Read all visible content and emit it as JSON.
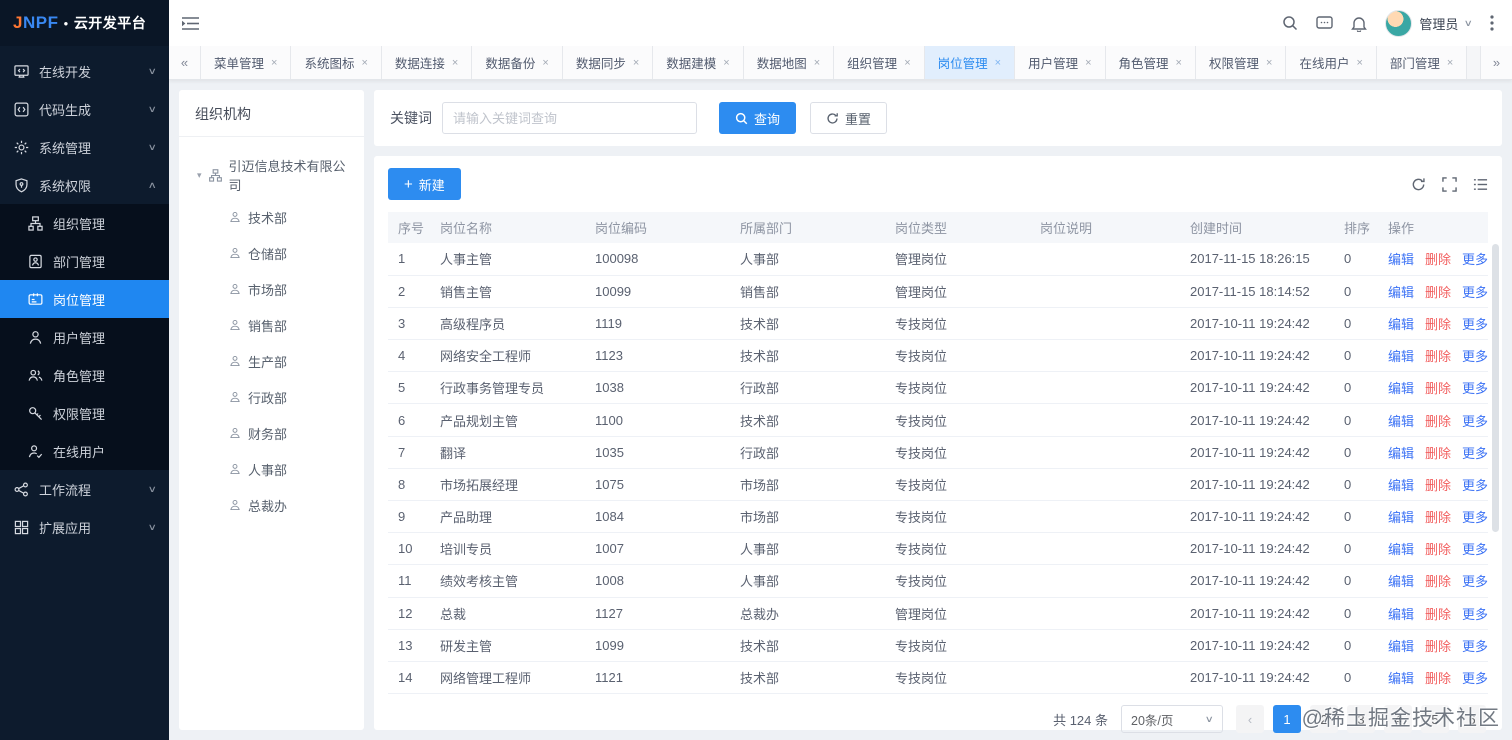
{
  "logo": {
    "brand_j": "J",
    "brand_rest": "NPF",
    "separator": "●",
    "name": "云开发平台"
  },
  "sidebar": {
    "groups_top": [
      {
        "label": "在线开发",
        "slug": "online-dev",
        "icon": "monitor-code-icon",
        "expanded": false
      },
      {
        "label": "代码生成",
        "slug": "code-generate",
        "icon": "code-icon",
        "expanded": false
      },
      {
        "label": "系统管理",
        "slug": "system-manage",
        "icon": "gear-icon",
        "expanded": false
      },
      {
        "label": "系统权限",
        "slug": "system-auth",
        "icon": "shield-icon",
        "expanded": true
      }
    ],
    "submenu": [
      {
        "label": "组织管理",
        "slug": "org-manage",
        "icon": "sitemap-icon",
        "active": false
      },
      {
        "label": "部门管理",
        "slug": "dept-manage",
        "icon": "badge-icon",
        "active": false
      },
      {
        "label": "岗位管理",
        "slug": "position-manage",
        "icon": "id-card-icon",
        "active": true
      },
      {
        "label": "用户管理",
        "slug": "user-manage",
        "icon": "user-icon",
        "active": false
      },
      {
        "label": "角色管理",
        "slug": "role-manage",
        "icon": "users-icon",
        "active": false
      },
      {
        "label": "权限管理",
        "slug": "perm-manage",
        "icon": "key-user-icon",
        "active": false
      },
      {
        "label": "在线用户",
        "slug": "online-user",
        "icon": "user-check-icon",
        "active": false
      }
    ],
    "groups_bottom": [
      {
        "label": "工作流程",
        "slug": "workflow",
        "icon": "nodes-icon",
        "expanded": false
      },
      {
        "label": "扩展应用",
        "slug": "extend-app",
        "icon": "grid-icon",
        "expanded": false
      }
    ]
  },
  "header": {
    "user": "管理员"
  },
  "tabs": [
    {
      "label": "菜单管理",
      "slug": "menu-manage",
      "active": false
    },
    {
      "label": "系统图标",
      "slug": "system-icons",
      "active": false
    },
    {
      "label": "数据连接",
      "slug": "data-connect",
      "active": false
    },
    {
      "label": "数据备份",
      "slug": "data-backup",
      "active": false
    },
    {
      "label": "数据同步",
      "slug": "data-sync",
      "active": false
    },
    {
      "label": "数据建模",
      "slug": "data-model",
      "active": false
    },
    {
      "label": "数据地图",
      "slug": "data-map",
      "active": false
    },
    {
      "label": "组织管理",
      "slug": "org-manage",
      "active": false
    },
    {
      "label": "岗位管理",
      "slug": "position-manage",
      "active": true
    },
    {
      "label": "用户管理",
      "slug": "user-manage",
      "active": false
    },
    {
      "label": "角色管理",
      "slug": "role-manage",
      "active": false
    },
    {
      "label": "权限管理",
      "slug": "perm-manage",
      "active": false
    },
    {
      "label": "在线用户",
      "slug": "online-user",
      "active": false
    },
    {
      "label": "部门管理",
      "slug": "dept-manage",
      "active": false
    }
  ],
  "tree": {
    "title": "组织机构",
    "root": "引迈信息技术有限公司",
    "children": [
      "技术部",
      "仓储部",
      "市场部",
      "销售部",
      "生产部",
      "行政部",
      "财务部",
      "人事部",
      "总裁办"
    ]
  },
  "filter": {
    "label": "关键词",
    "placeholder": "请输入关键词查询",
    "search_label": "查询",
    "reset_label": "重置"
  },
  "toolbar": {
    "new_label": "新建"
  },
  "table": {
    "headers": [
      "序号",
      "岗位名称",
      "岗位编码",
      "所属部门",
      "岗位类型",
      "岗位说明",
      "创建时间",
      "排序",
      "操作"
    ],
    "actions": {
      "edit": "编辑",
      "delete": "删除",
      "more": "更多"
    },
    "rows": [
      [
        "1",
        "人事主管",
        "100098",
        "人事部",
        "管理岗位",
        "",
        "2017-11-15 18:26:15",
        "0"
      ],
      [
        "2",
        "销售主管",
        "10099",
        "销售部",
        "管理岗位",
        "",
        "2017-11-15 18:14:52",
        "0"
      ],
      [
        "3",
        "高级程序员",
        "1119",
        "技术部",
        "专技岗位",
        "",
        "2017-10-11 19:24:42",
        "0"
      ],
      [
        "4",
        "网络安全工程师",
        "1123",
        "技术部",
        "专技岗位",
        "",
        "2017-10-11 19:24:42",
        "0"
      ],
      [
        "5",
        "行政事务管理专员",
        "1038",
        "行政部",
        "专技岗位",
        "",
        "2017-10-11 19:24:42",
        "0"
      ],
      [
        "6",
        "产品规划主管",
        "1100",
        "技术部",
        "专技岗位",
        "",
        "2017-10-11 19:24:42",
        "0"
      ],
      [
        "7",
        "翻译",
        "1035",
        "行政部",
        "专技岗位",
        "",
        "2017-10-11 19:24:42",
        "0"
      ],
      [
        "8",
        "市场拓展经理",
        "1075",
        "市场部",
        "专技岗位",
        "",
        "2017-10-11 19:24:42",
        "0"
      ],
      [
        "9",
        "产品助理",
        "1084",
        "市场部",
        "专技岗位",
        "",
        "2017-10-11 19:24:42",
        "0"
      ],
      [
        "10",
        "培训专员",
        "1007",
        "人事部",
        "专技岗位",
        "",
        "2017-10-11 19:24:42",
        "0"
      ],
      [
        "11",
        "绩效考核主管",
        "1008",
        "人事部",
        "专技岗位",
        "",
        "2017-10-11 19:24:42",
        "0"
      ],
      [
        "12",
        "总裁",
        "1127",
        "总裁办",
        "管理岗位",
        "",
        "2017-10-11 19:24:42",
        "0"
      ],
      [
        "13",
        "研发主管",
        "1099",
        "技术部",
        "专技岗位",
        "",
        "2017-10-11 19:24:42",
        "0"
      ],
      [
        "14",
        "网络管理工程师",
        "1121",
        "技术部",
        "专技岗位",
        "",
        "2017-10-11 19:24:42",
        "0"
      ]
    ]
  },
  "pagination": {
    "total": "共 124 条",
    "page_size": "20条/页",
    "pages": [
      "1",
      "2",
      "3",
      "4",
      "5",
      "6"
    ],
    "active_page": "1"
  },
  "watermark": {
    "text": "@稀土掘金技术社区"
  },
  "colors": {
    "primary": "#2d8cf0",
    "sidebar_bg": "#0d1b2d",
    "sidebar_active": "#1f87f1",
    "link_blue": "#3d73f5",
    "danger_red": "#f25e5e",
    "tab_active_bg": "#e1eefd",
    "logo_j": "#ff7733",
    "logo_npf": "#3988f2"
  }
}
